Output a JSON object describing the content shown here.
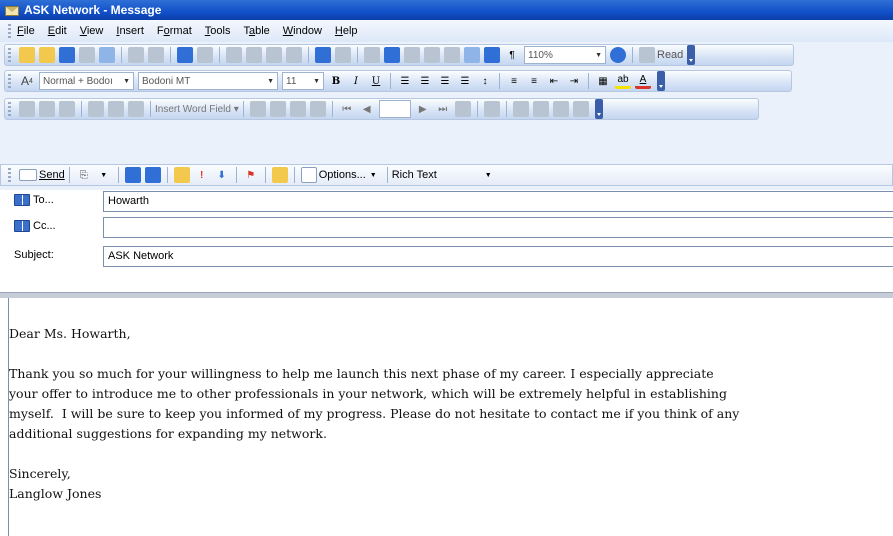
{
  "window": {
    "title": "ASK Network - Message"
  },
  "menu": [
    {
      "label": "File",
      "key": "F",
      "rest": "ile"
    },
    {
      "label": "Edit",
      "key": "E",
      "rest": "dit"
    },
    {
      "label": "View",
      "key": "V",
      "rest": "iew"
    },
    {
      "label": "Insert",
      "key": "I",
      "rest": "nsert"
    },
    {
      "label": "Format",
      "key": "o",
      "pre": "F",
      "rest": "rmat"
    },
    {
      "label": "Tools",
      "key": "T",
      "rest": "ools"
    },
    {
      "label": "Table",
      "key": "a",
      "pre": "T",
      "rest": "ble"
    },
    {
      "label": "Window",
      "key": "W",
      "rest": "indow"
    },
    {
      "label": "Help",
      "key": "H",
      "rest": "elp"
    }
  ],
  "toolbar_standard": {
    "zoom": "110%",
    "read_label": "Read"
  },
  "toolbar_format": {
    "style": "Normal + Bodoı",
    "font": "Bodoni MT",
    "size": "11",
    "bold": "B",
    "italic": "I",
    "underline": "U"
  },
  "toolbar_mailmerge": {
    "insert_word_field": "Insert Word Field ▾"
  },
  "toolbar_email": {
    "send": "Send",
    "options": "Options...",
    "format": "Rich Text"
  },
  "fields": {
    "to_label": "To...",
    "to_value": "Howarth",
    "cc_label": "Cc...",
    "cc_value": "",
    "subject_label": "Subject:",
    "subject_value": "ASK Network"
  },
  "body": {
    "greeting": "Dear Ms. Howarth,",
    "paragraph": "Thank you so much for your willingness to help me launch this next phase of my career. I especially appreciate\nyour offer to introduce me to other professionals in your network, which will be extremely helpful in establishing\nmyself.  I will be sure to keep you informed of my progress. Please do not hesitate to contact me if you think of any\nadditional suggestions for expanding my network.",
    "closing": "Sincerely,",
    "signature": "Langlow Jones"
  }
}
